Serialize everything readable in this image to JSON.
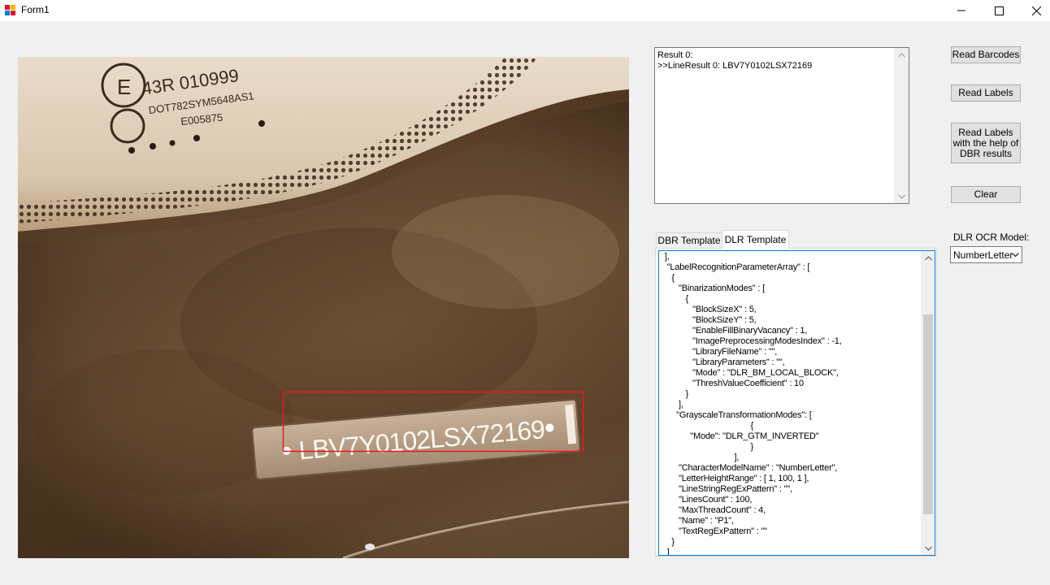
{
  "window": {
    "title": "Form1"
  },
  "image": {
    "plate_text": "LBV7Y0102LSX72169",
    "stamp_line1": "43R 010999",
    "stamp_line2": "DOT782SYM5648AS1",
    "stamp_line3": "E005875",
    "highlight_color": "#e01e1e"
  },
  "results": {
    "text": "Result 0:\n>>LineResult 0: LBV7Y0102LSX72169"
  },
  "buttons": {
    "read_barcodes": "Read Barcodes",
    "read_labels": "Read Labels",
    "read_labels_dbr": "Read Labels\nwith the help of\nDBR results",
    "clear": "Clear"
  },
  "ocr_model": {
    "label": "DLR OCR Model:",
    "selected": "NumberLetter"
  },
  "tabs": [
    {
      "label": "DBR Template",
      "active": false
    },
    {
      "label": "DLR Template",
      "active": true
    }
  ],
  "template": {
    "text": " ],\n  \"LabelRecognitionParameterArray\" : [\n    {\n       \"BinarizationModes\" : [\n          {\n             \"BlockSizeX\" : 5,\n             \"BlockSizeY\" : 5,\n             \"EnableFillBinaryVacancy\" : 1,\n             \"ImagePreprocessingModesIndex\" : -1,\n             \"LibraryFileName\" : \"\",\n             \"LibraryParameters\" : \"\",\n             \"Mode\" : \"DLR_BM_LOCAL_BLOCK\",\n             \"ThreshValueCoefficient\" : 10\n          }\n       ],\n      \"GrayscaleTransformationModes\": [\n                                      {\n            \"Mode\": \"DLR_GTM_INVERTED\"\n                                      }\n                               ],\n       \"CharacterModelName\" : \"NumberLetter\",\n       \"LetterHeightRange\" : [ 1, 100, 1 ],\n       \"LineStringRegExPattern\" : \"\",\n       \"LinesCount\" : 100,\n       \"MaxThreadCount\" : 4,\n       \"Name\" : \"P1\",\n       \"TextRegExPattern\" : \"\"\n    }\n  ]"
  }
}
